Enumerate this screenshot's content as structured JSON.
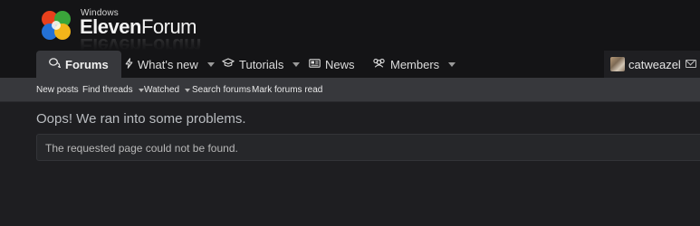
{
  "logo": {
    "small_text": "Windows",
    "brand_bold": "Eleven",
    "brand_thin": "Forum"
  },
  "nav": {
    "tabs": [
      {
        "label": "Forums",
        "icon": "chat-bubbles-icon",
        "active": true
      },
      {
        "label": "What's new",
        "icon": "lightning-icon",
        "has_dropdown": true
      },
      {
        "label": "Tutorials",
        "icon": "graduation-cap-icon",
        "has_dropdown": true
      },
      {
        "label": "News",
        "icon": "newspaper-icon"
      },
      {
        "label": "Members",
        "icon": "users-icon",
        "has_dropdown": true
      }
    ],
    "user": {
      "name": "catweazel",
      "icon": "avatar"
    },
    "inbox_icon": "envelope-icon"
  },
  "subnav": {
    "items": [
      {
        "label": "New posts"
      },
      {
        "label": "Find threads",
        "has_dropdown": true
      },
      {
        "label": "Watched",
        "has_dropdown": true
      },
      {
        "label": "Search forums"
      },
      {
        "label": "Mark forums read"
      }
    ]
  },
  "main": {
    "title": "Oops! We ran into some problems.",
    "notice": "The requested page could not be found."
  },
  "colors": {
    "background": "#1e1e21",
    "header": "#141416",
    "subnav": "#37383c",
    "active_tab": "#37383c"
  }
}
